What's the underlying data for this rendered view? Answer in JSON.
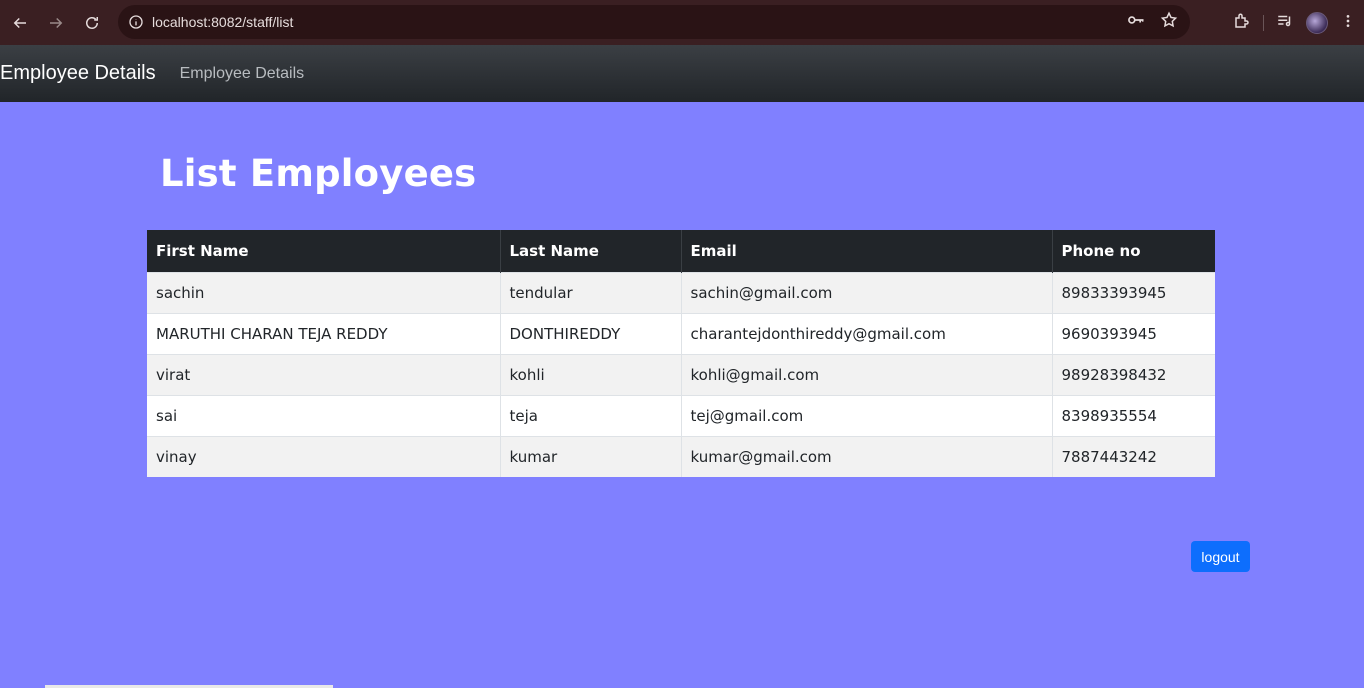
{
  "browser": {
    "url": "localhost:8082/staff/list"
  },
  "navbar": {
    "brand": "Employee Details",
    "link": "Employee Details"
  },
  "page": {
    "title": "List Employees"
  },
  "table": {
    "headers": [
      "First Name",
      "Last Name",
      "Email",
      "Phone no"
    ],
    "rows": [
      [
        "sachin",
        "tendular",
        "sachin@gmail.com",
        "89833393945"
      ],
      [
        "MARUTHI CHARAN TEJA REDDY",
        "DONTHIREDDY",
        "charantejdonthireddy@gmail.com",
        "9690393945"
      ],
      [
        "virat",
        "kohli",
        "kohli@gmail.com",
        "98928398432"
      ],
      [
        "sai",
        "teja",
        "tej@gmail.com",
        "8398935554"
      ],
      [
        "vinay",
        "kumar",
        "kumar@gmail.com",
        "7887443242"
      ]
    ]
  },
  "actions": {
    "logout_label": "logout"
  },
  "colors": {
    "page_bg": "#8080ff",
    "navbar_bg": "#212529",
    "button_primary": "#0d6efd"
  }
}
